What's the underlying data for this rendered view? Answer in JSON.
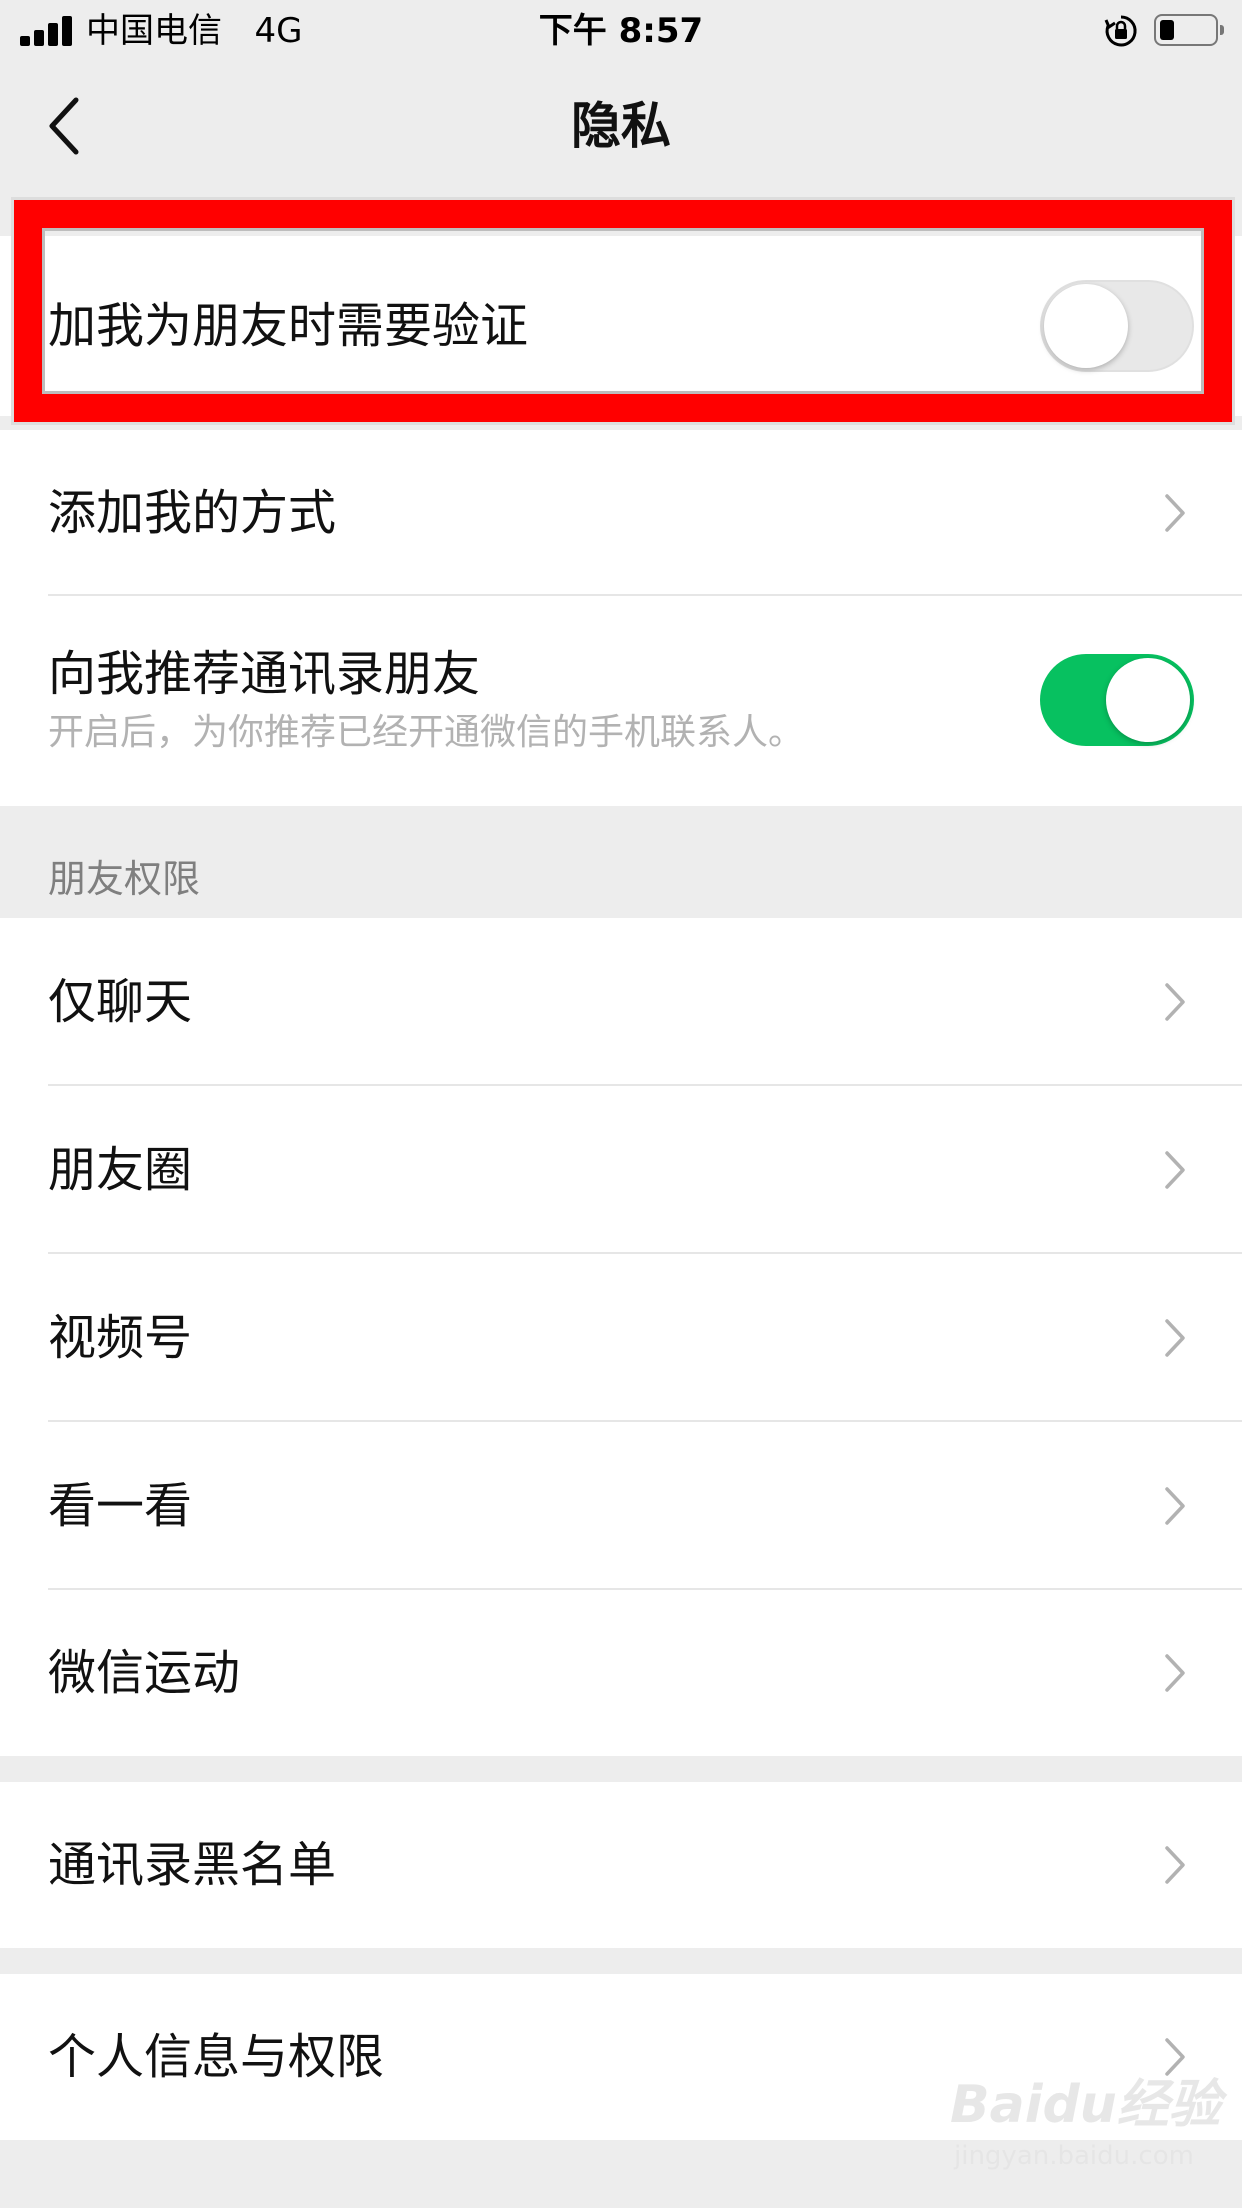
{
  "status_bar": {
    "carrier": "中国电信",
    "network": "4G",
    "time": "下午 8:57"
  },
  "nav": {
    "title": "隐私",
    "back_icon": "chevron-left-icon"
  },
  "verify_group": {
    "label": "加我为朋友时需要验证",
    "toggle_on": false
  },
  "contact_group": {
    "add_methods_label": "添加我的方式",
    "recommend_label": "向我推荐通讯录朋友",
    "recommend_sub": "开启后，为你推荐已经开通微信的手机联系人。",
    "recommend_on": true
  },
  "friend_permissions": {
    "header": "朋友权限",
    "items": [
      {
        "label": "仅聊天"
      },
      {
        "label": "朋友圈"
      },
      {
        "label": "视频号"
      },
      {
        "label": "看一看"
      },
      {
        "label": "微信运动"
      }
    ]
  },
  "blacklist": {
    "label": "通讯录黑名单"
  },
  "personal_info": {
    "label": "个人信息与权限"
  },
  "watermark": {
    "main": "Baidu经验",
    "sub": "jingyan.baidu.com"
  },
  "colors": {
    "accent_green": "#07c160",
    "highlight_red": "#ff0000",
    "background": "#ededed"
  }
}
